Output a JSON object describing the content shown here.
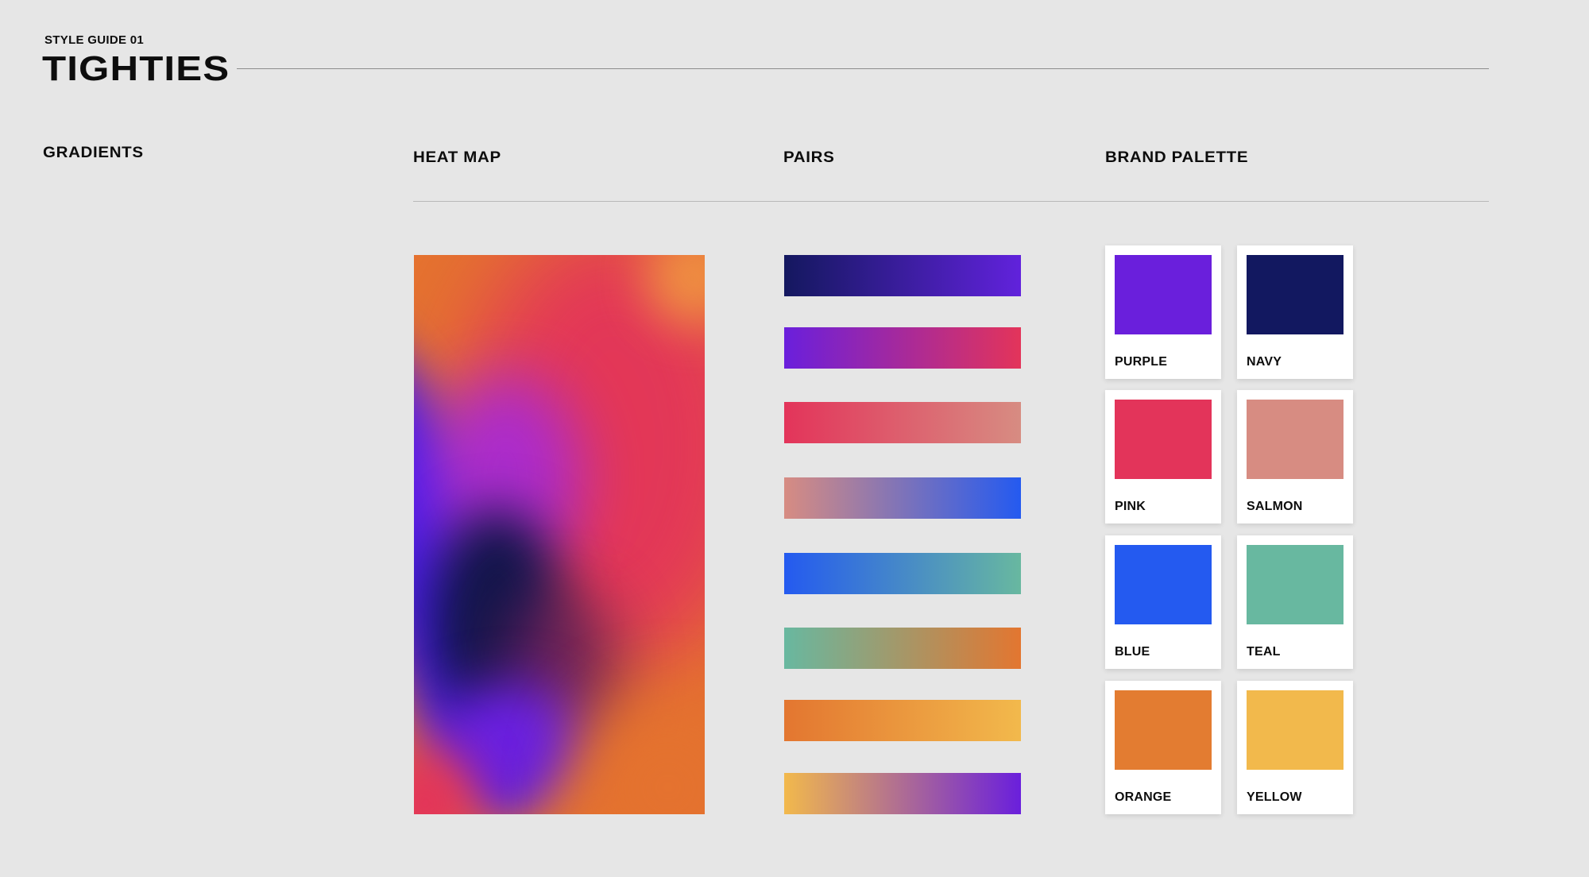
{
  "header": {
    "subtitle": "STYLE GUIDE 01",
    "title": "TIGHTIES"
  },
  "sections": {
    "gradients": "GRADIENTS",
    "heat_map": "HEAT MAP",
    "pairs": "PAIRS",
    "brand_palette": "BRAND PALETTE"
  },
  "pairs": [
    {
      "from": "#14185f",
      "to": "#6122dc"
    },
    {
      "from": "#6a1fdc",
      "to": "#e3345a"
    },
    {
      "from": "#e3345a",
      "to": "#d78c82"
    },
    {
      "from": "#d78c82",
      "to": "#245af0"
    },
    {
      "from": "#245af0",
      "to": "#68b8a0"
    },
    {
      "from": "#68b8a0",
      "to": "#e37630"
    },
    {
      "from": "#e37630",
      "to": "#f2b94c"
    },
    {
      "from": "#f2b94c",
      "to": "#6a1fdc"
    }
  ],
  "palette": [
    {
      "name": "PURPLE",
      "color": "#6a1fdc"
    },
    {
      "name": "NAVY",
      "color": "#121860"
    },
    {
      "name": "PINK",
      "color": "#e3345a"
    },
    {
      "name": "SALMON",
      "color": "#d78c82"
    },
    {
      "name": "BLUE",
      "color": "#245af0"
    },
    {
      "name": "TEAL",
      "color": "#68b8a0"
    },
    {
      "name": "ORANGE",
      "color": "#e37c31"
    },
    {
      "name": "YELLOW",
      "color": "#f2b94c"
    }
  ]
}
